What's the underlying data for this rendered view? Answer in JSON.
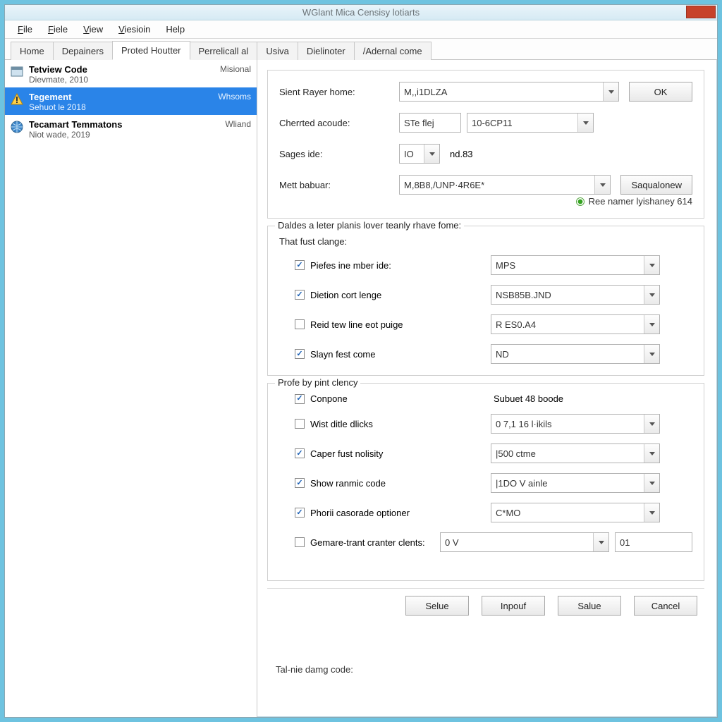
{
  "titlebar": {
    "title": "WGlant Mica Censisy lotiarts"
  },
  "menubar": [
    {
      "label": "File"
    },
    {
      "label": "Fiele"
    },
    {
      "label": "View"
    },
    {
      "label": "Viesioin"
    },
    {
      "label": "Help"
    }
  ],
  "tabs": [
    {
      "label": "Home"
    },
    {
      "label": "Depainers"
    },
    {
      "label": "Proted Houtter",
      "active": true
    },
    {
      "label": "Perrelicall al"
    },
    {
      "label": "Usiva"
    },
    {
      "label": "Dielinoter"
    },
    {
      "label": "/Adernal come"
    }
  ],
  "sidebar": [
    {
      "icon": "window",
      "title": "Tetview Code",
      "subtitle": "Dievmate, 2010",
      "tag": "Misional"
    },
    {
      "icon": "warning",
      "title": "Tegement",
      "subtitle": "Sehuot le 2018",
      "tag": "Whsoms",
      "selected": true
    },
    {
      "icon": "globe",
      "title": "Tecamart Temmatons",
      "subtitle": "Niot wade, 2019",
      "tag": "Wliand"
    }
  ],
  "panel1": {
    "rows": {
      "r1": {
        "label": "Sient Rayer home:",
        "value": "M,,i1DLZA",
        "btn": "OK"
      },
      "r2": {
        "label": "Cherrted acoude:",
        "left": "STe flej",
        "right": "10-6CP11"
      },
      "r3": {
        "label": "Sages ide:",
        "combo": "IO",
        "suffix": "nd.83"
      },
      "r4": {
        "label": "Mett babuar:",
        "value": "M,8B8,/UNP·4R6E*",
        "btn": "Saqualonew"
      }
    },
    "radio": "Ree namer lyishaney 614"
  },
  "panel2": {
    "title": "Daldes a leter planis lover teanly rhave fome:",
    "sub_title": "That fust clange:",
    "rows": [
      {
        "checked": true,
        "label": "Piefes ine mber ide:",
        "combo": "MPS"
      },
      {
        "checked": true,
        "label": "Dietion cort lenge",
        "combo": "NSB85B.JND"
      },
      {
        "checked": false,
        "label": "Reid tew line eot puige",
        "combo": "R ES0.A4"
      },
      {
        "checked": true,
        "label": "Slayn fest come",
        "combo": "ND"
      }
    ]
  },
  "panel3": {
    "title": "Profe by pint clency",
    "static_label": "Subuet 48 boode",
    "rows": [
      {
        "checked": true,
        "label": "Conpone"
      },
      {
        "checked": false,
        "label": "Wist ditle dlicks",
        "combo": "0 7,1 16 l·ikils"
      },
      {
        "checked": true,
        "label": "Caper fust nolisity",
        "combo": "|500 ctme"
      },
      {
        "checked": true,
        "label": "Show ranmic code",
        "combo": "|1DO V ainle"
      },
      {
        "checked": true,
        "label": "Phorii casorade optioner",
        "combo": "C*MO"
      },
      {
        "checked": false,
        "label": "Gemare-trant cranter clents:",
        "combo": "0 V",
        "combo2": "01"
      }
    ]
  },
  "bottom": {
    "label": "Tal-nie damg code:",
    "buttons": [
      "Selue",
      "Inpouf",
      "Salue",
      "Cancel"
    ]
  }
}
